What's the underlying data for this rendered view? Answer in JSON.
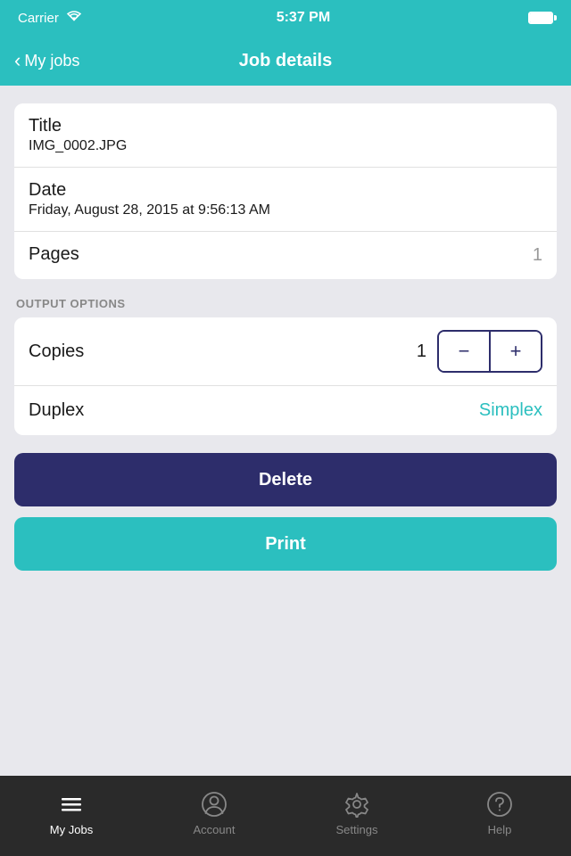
{
  "statusBar": {
    "carrier": "Carrier",
    "time": "5:37 PM"
  },
  "navBar": {
    "backLabel": "My jobs",
    "title": "Job details"
  },
  "jobDetails": {
    "titleLabel": "Title",
    "titleValue": "IMG_0002.JPG",
    "dateLabel": "Date",
    "dateValue": "Friday, August 28, 2015 at 9:56:13 AM",
    "pagesLabel": "Pages",
    "pagesValue": "1"
  },
  "outputOptions": {
    "sectionLabel": "OUTPUT OPTIONS",
    "copiesLabel": "Copies",
    "copiesValue": "1",
    "decrementLabel": "−",
    "incrementLabel": "+",
    "duplexLabel": "Duplex",
    "duplexValue": "Simplex"
  },
  "buttons": {
    "deleteLabel": "Delete",
    "printLabel": "Print"
  },
  "tabBar": {
    "tabs": [
      {
        "id": "my-jobs",
        "label": "My Jobs",
        "active": true
      },
      {
        "id": "account",
        "label": "Account",
        "active": false
      },
      {
        "id": "settings",
        "label": "Settings",
        "active": false
      },
      {
        "id": "help",
        "label": "Help",
        "active": false
      }
    ]
  }
}
